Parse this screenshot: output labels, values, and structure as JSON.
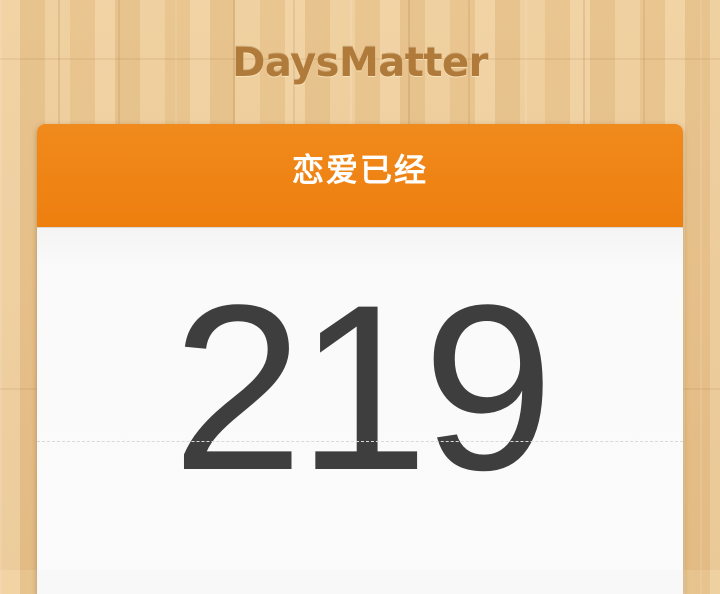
{
  "app": {
    "title": "DaysMatter"
  },
  "card": {
    "header_label": "恋爱已经",
    "day_count": "219"
  },
  "colors": {
    "header_bg": "#ef8212",
    "title_text": "#b07a3a",
    "count_text": "#3e3e3e",
    "background_wood": "#e8c48f"
  }
}
